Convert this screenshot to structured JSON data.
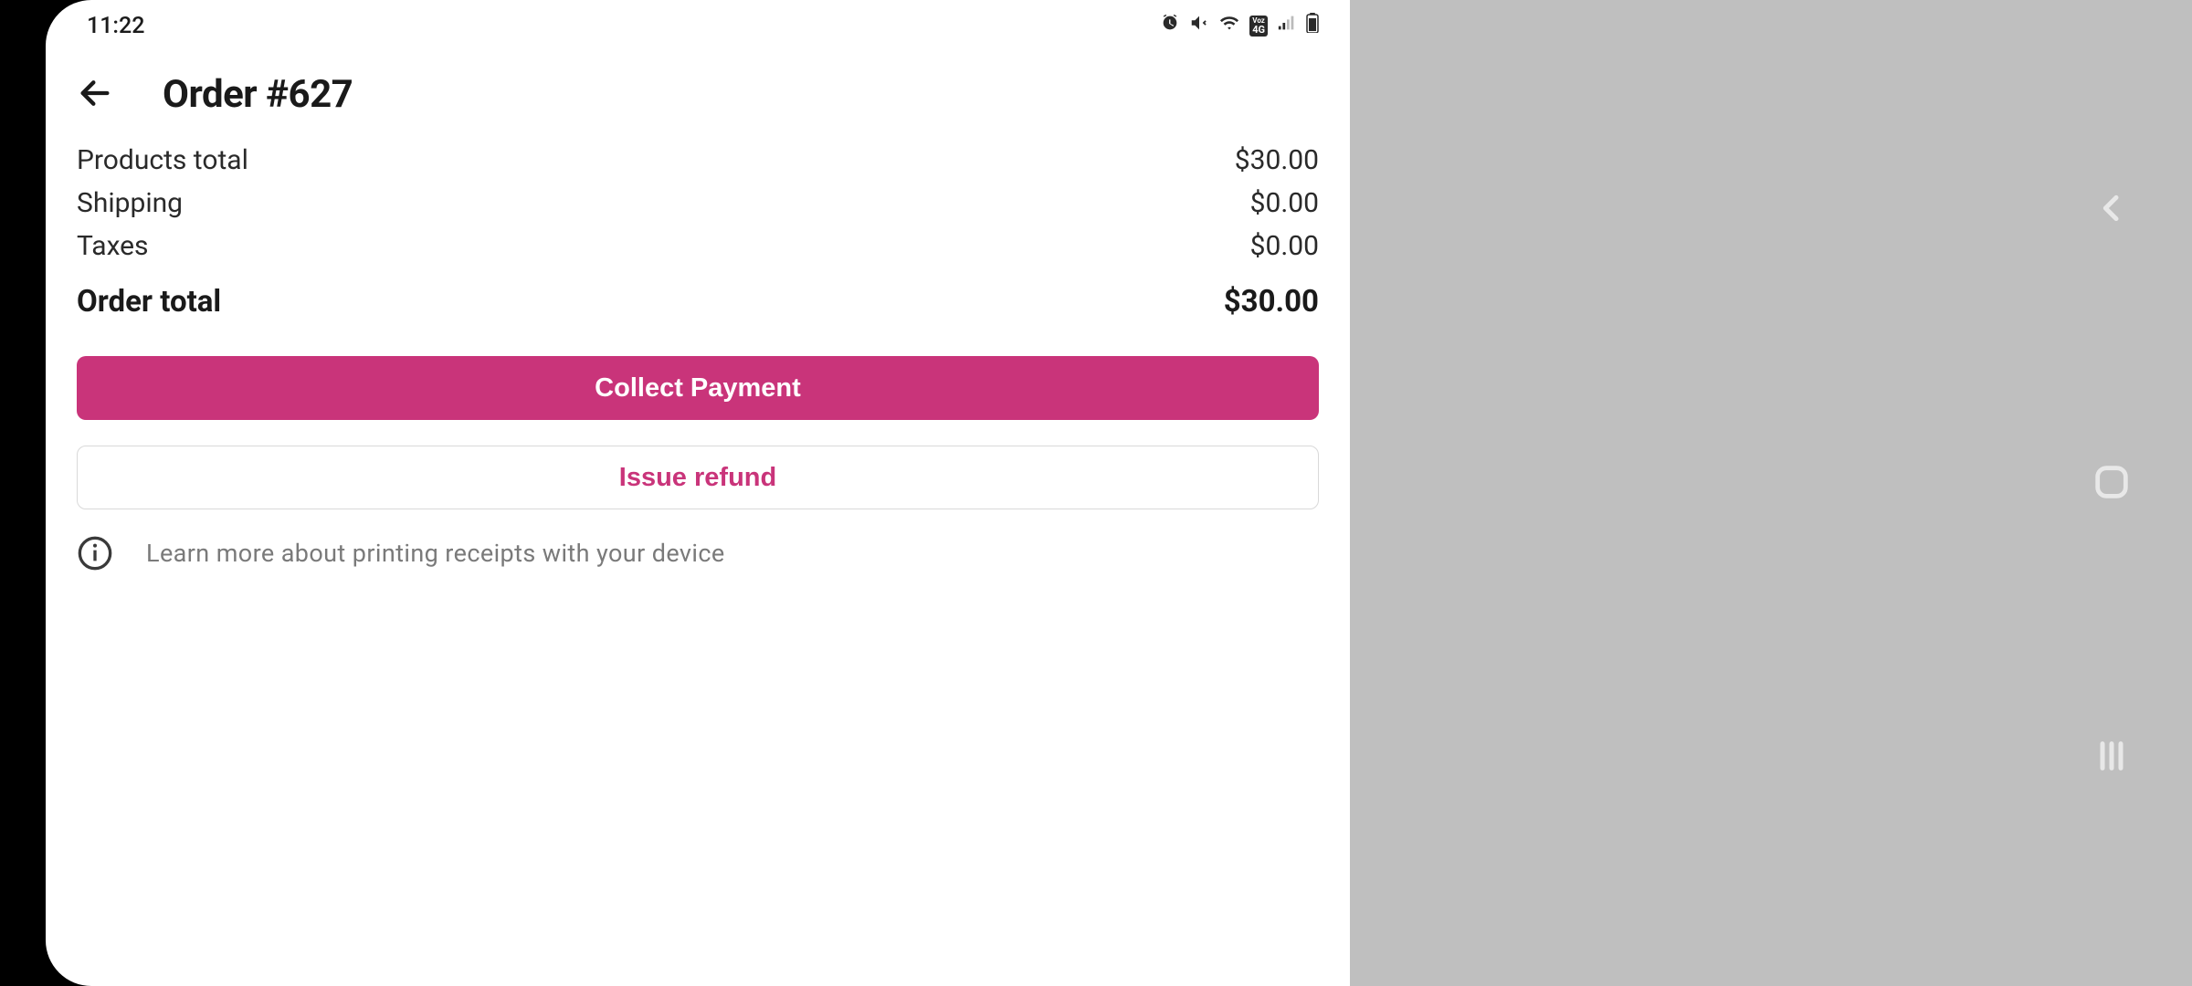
{
  "status": {
    "time": "11:22"
  },
  "header": {
    "title": "Order #627"
  },
  "summary": {
    "products_label": "Products total",
    "products_value": "$30.00",
    "shipping_label": "Shipping",
    "shipping_value": "$0.00",
    "taxes_label": "Taxes",
    "taxes_value": "$0.00",
    "total_label": "Order total",
    "total_value": "$30.00"
  },
  "actions": {
    "collect_label": "Collect Payment",
    "refund_label": "Issue refund"
  },
  "info": {
    "text": "Learn more about printing receipts with your device"
  },
  "colors": {
    "accent": "#c9347a"
  }
}
